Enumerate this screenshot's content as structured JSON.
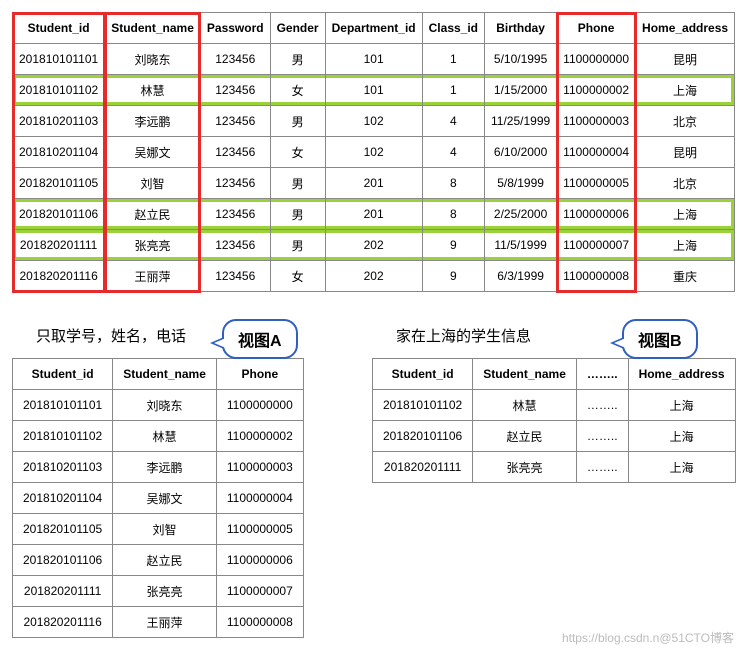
{
  "main": {
    "headers": [
      "Student_id",
      "Student_name",
      "Password",
      "Gender",
      "Department_id",
      "Class_id",
      "Birthday",
      "Phone",
      "Home_address"
    ],
    "rows": [
      {
        "Student_id": "201810101101",
        "Student_name": "刘晓东",
        "Password": "123456",
        "Gender": "男",
        "Department_id": "101",
        "Class_id": "1",
        "Birthday": "5/10/1995",
        "Phone": "1100000000",
        "Home_address": "昆明",
        "hl": false
      },
      {
        "Student_id": "201810101102",
        "Student_name": "林慧",
        "Password": "123456",
        "Gender": "女",
        "Department_id": "101",
        "Class_id": "1",
        "Birthday": "1/15/2000",
        "Phone": "1100000002",
        "Home_address": "上海",
        "hl": true
      },
      {
        "Student_id": "201810201103",
        "Student_name": "李远鹏",
        "Password": "123456",
        "Gender": "男",
        "Department_id": "102",
        "Class_id": "4",
        "Birthday": "11/25/1999",
        "Phone": "1100000003",
        "Home_address": "北京",
        "hl": false
      },
      {
        "Student_id": "201810201104",
        "Student_name": "吴娜文",
        "Password": "123456",
        "Gender": "女",
        "Department_id": "102",
        "Class_id": "4",
        "Birthday": "6/10/2000",
        "Phone": "1100000004",
        "Home_address": "昆明",
        "hl": false
      },
      {
        "Student_id": "201820101105",
        "Student_name": "刘智",
        "Password": "123456",
        "Gender": "男",
        "Department_id": "201",
        "Class_id": "8",
        "Birthday": "5/8/1999",
        "Phone": "1100000005",
        "Home_address": "北京",
        "hl": false
      },
      {
        "Student_id": "201820101106",
        "Student_name": "赵立民",
        "Password": "123456",
        "Gender": "男",
        "Department_id": "201",
        "Class_id": "8",
        "Birthday": "2/25/2000",
        "Phone": "1100000006",
        "Home_address": "上海",
        "hl": true
      },
      {
        "Student_id": "201820201111",
        "Student_name": "张亮亮",
        "Password": "123456",
        "Gender": "男",
        "Department_id": "202",
        "Class_id": "9",
        "Birthday": "11/5/1999",
        "Phone": "1100000007",
        "Home_address": "上海",
        "hl": true
      },
      {
        "Student_id": "201820201116",
        "Student_name": "王丽萍",
        "Password": "123456",
        "Gender": "女",
        "Department_id": "202",
        "Class_id": "9",
        "Birthday": "6/3/1999",
        "Phone": "1100000008",
        "Home_address": "重庆",
        "hl": false
      }
    ],
    "red_columns": [
      "Student_id",
      "Student_name",
      "Phone"
    ]
  },
  "viewA": {
    "caption": "只取学号，姓名，电话",
    "bubble": "视图A",
    "headers": [
      "Student_id",
      "Student_name",
      "Phone"
    ],
    "rows": [
      {
        "Student_id": "201810101101",
        "Student_name": "刘晓东",
        "Phone": "1100000000"
      },
      {
        "Student_id": "201810101102",
        "Student_name": "林慧",
        "Phone": "1100000002"
      },
      {
        "Student_id": "201810201103",
        "Student_name": "李远鹏",
        "Phone": "1100000003"
      },
      {
        "Student_id": "201810201104",
        "Student_name": "吴娜文",
        "Phone": "1100000004"
      },
      {
        "Student_id": "201820101105",
        "Student_name": "刘智",
        "Phone": "1100000005"
      },
      {
        "Student_id": "201820101106",
        "Student_name": "赵立民",
        "Phone": "1100000006"
      },
      {
        "Student_id": "201820201111",
        "Student_name": "张亮亮",
        "Phone": "1100000007"
      },
      {
        "Student_id": "201820201116",
        "Student_name": "王丽萍",
        "Phone": "1100000008"
      }
    ]
  },
  "viewB": {
    "caption": "家在上海的学生信息",
    "bubble": "视图B",
    "headers": [
      "Student_id",
      "Student_name",
      "……..",
      "Home_address"
    ],
    "omit": "……..",
    "rows": [
      {
        "Student_id": "201810101102",
        "Student_name": "林慧",
        "Home_address": "上海"
      },
      {
        "Student_id": "201820101106",
        "Student_name": "赵立民",
        "Home_address": "上海"
      },
      {
        "Student_id": "201820201111",
        "Student_name": "张亮亮",
        "Home_address": "上海"
      }
    ]
  },
  "watermark": "https://blog.csdn.n@51CTO博客"
}
